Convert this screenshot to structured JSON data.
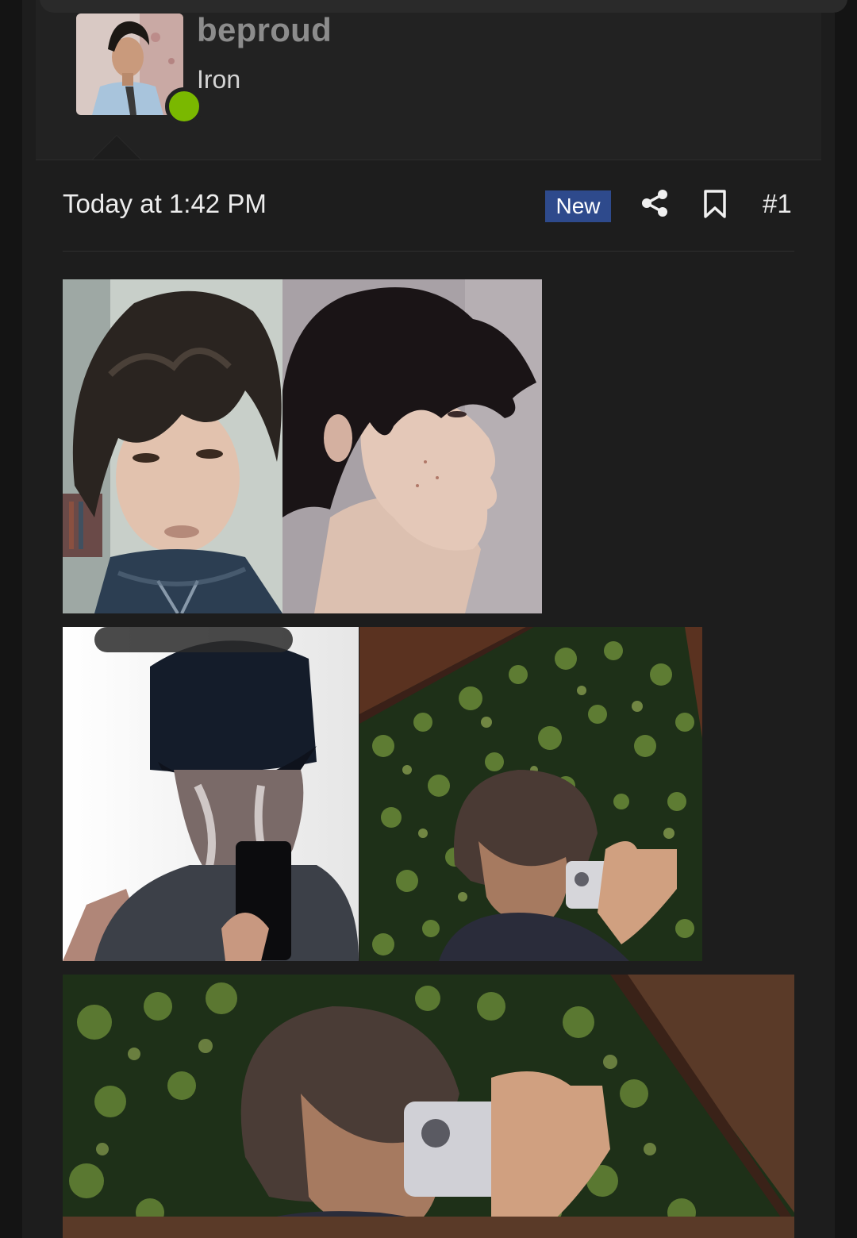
{
  "user": {
    "username": "beproud",
    "title": "Iron",
    "status": "online",
    "status_color": "#7ab800"
  },
  "post": {
    "date": "Today at 1:42 PM",
    "badge": "New",
    "badge_color": "#2e4a8c",
    "number": "#1"
  },
  "icons": {
    "share": "share-icon",
    "bookmark": "bookmark-icon"
  },
  "attachments": [
    {
      "name": "photo-1"
    },
    {
      "name": "photo-2"
    },
    {
      "name": "photo-3"
    },
    {
      "name": "photo-4"
    },
    {
      "name": "photo-5"
    }
  ]
}
